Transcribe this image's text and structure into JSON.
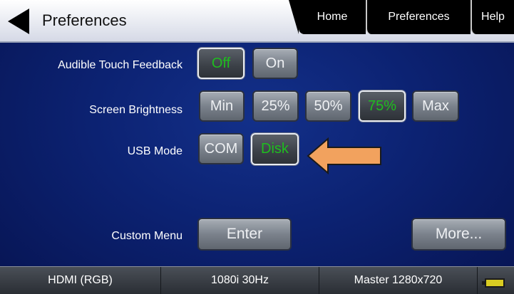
{
  "header": {
    "title": "Preferences",
    "back_icon": "back-arrow-icon",
    "tabs": [
      {
        "label": "Home"
      },
      {
        "label": "Preferences"
      },
      {
        "label": "Help"
      }
    ]
  },
  "rows": {
    "audible": {
      "label": "Audible Touch Feedback",
      "options": [
        "Off",
        "On"
      ],
      "selected": "Off"
    },
    "brightness": {
      "label": "Screen Brightness",
      "options": [
        "Min",
        "25%",
        "50%",
        "75%",
        "Max"
      ],
      "selected": "75%"
    },
    "usb": {
      "label": "USB Mode",
      "options": [
        "COM",
        "Disk"
      ],
      "selected": "Disk"
    },
    "custom_menu": {
      "label": "Custom Menu",
      "enter_label": "Enter",
      "more_label": "More..."
    }
  },
  "annotation": {
    "icon": "orange-pointer-arrow-icon",
    "color": "#f2a25e"
  },
  "status_bar": {
    "video_interface": "HDMI (RGB)",
    "format": "1080i 30Hz",
    "timing": "Master 1280x720",
    "battery_icon": "battery-icon"
  },
  "colors": {
    "background": "#0c2272",
    "selected_text": "#1fbd1f",
    "accent_arrow": "#f2a25e"
  }
}
